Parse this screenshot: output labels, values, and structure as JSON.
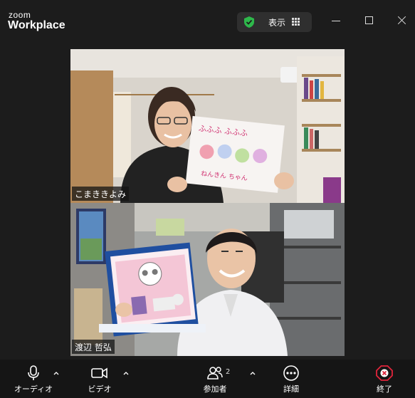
{
  "app": {
    "brand_small": "zoom",
    "brand_main": "Workplace"
  },
  "header": {
    "view_label": "表示",
    "icons": [
      "shield-check-icon",
      "grid-icon",
      "minimize-icon",
      "maximize-icon",
      "close-icon"
    ]
  },
  "participants": [
    {
      "name": "こまききよみ"
    },
    {
      "name": "渡辺 哲弘"
    }
  ],
  "toolbar": {
    "audio_label": "オーディオ",
    "video_label": "ビデオ",
    "participants_label": "参加者",
    "participants_count": "2",
    "details_label": "詳細",
    "end_label": "終了"
  },
  "colors": {
    "background": "#1c1c1c",
    "toolbar": "#151515",
    "secure_green": "#2eb84b",
    "end_red": "#e0243b"
  }
}
